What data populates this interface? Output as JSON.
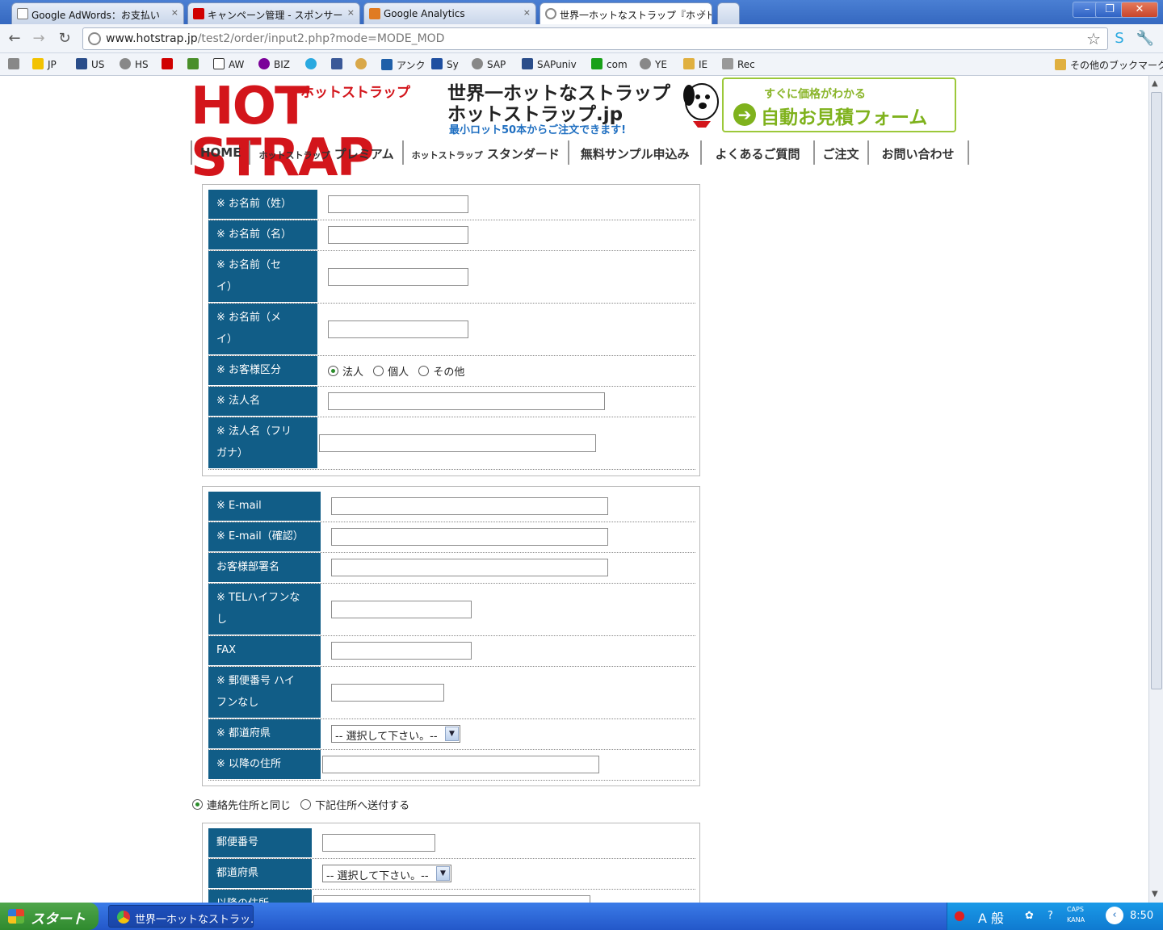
{
  "browser": {
    "tabs": [
      {
        "title": "Google AdWords：お支払い",
        "favicon_color": "#e8e8e8"
      },
      {
        "title": "キャンペーン管理 - スポンサー",
        "favicon_color": "#d00000"
      },
      {
        "title": "Google Analytics",
        "favicon_color": "#e07b22"
      },
      {
        "title": "世界一ホットなストラップ『ホット",
        "favicon_color": "#cfcfcf"
      }
    ],
    "tab_close_glyph": "×",
    "window_buttons": [
      "–",
      "❐",
      "✕"
    ],
    "url_host": "www.hotstrap.jp",
    "url_path": "/test2/order/input2.php?mode=MODE_MOD",
    "bookmarks": [
      {
        "label": "",
        "color": "#888"
      },
      {
        "label": "JP",
        "color": "#f2c200"
      },
      {
        "label": "US",
        "color": "#2a4d8a"
      },
      {
        "label": "HS",
        "color": "#888"
      },
      {
        "label": "",
        "color": "#d00000"
      },
      {
        "label": "",
        "color": "#4a8f2a"
      },
      {
        "label": "AW",
        "color": "#1a1a1a"
      },
      {
        "label": "BIZ",
        "color": "#7b0099"
      },
      {
        "label": "",
        "color": "#2aa9e0"
      },
      {
        "label": "",
        "color": "#3b5998"
      },
      {
        "label": "",
        "color": "#d9a84a"
      },
      {
        "label": "アンク",
        "color": "#1f5fa8"
      },
      {
        "label": "Sy",
        "color": "#1f4fa0"
      },
      {
        "label": "SAP",
        "color": "#888"
      },
      {
        "label": "SAPuniv",
        "color": "#2a4d8a"
      },
      {
        "label": "com",
        "color": "#19a019"
      },
      {
        "label": "YE",
        "color": "#888"
      },
      {
        "label": "IE",
        "color": "#e0b040"
      },
      {
        "label": "Rec",
        "color": "#999"
      }
    ],
    "other_bookmarks": "その他のブックマーク"
  },
  "header": {
    "logo_text": "HOT STRAP",
    "logo_kana": "ホットストラップ",
    "tagline_line1": "世界一ホットなストラップ",
    "tagline_line2": "ホットストラップ.jp",
    "tagline_line3": "最小ロット50本からご注文できます!",
    "estimate_small": "すぐに価格がわかる",
    "estimate_main": "自動お見積フォーム",
    "estimate_arrow": "➔"
  },
  "nav": [
    {
      "label": "HOME"
    },
    {
      "label_small": "ホットストラップ",
      "label": "プレミアム"
    },
    {
      "label_small": "ホットストラップ",
      "label": "スタンダード"
    },
    {
      "label": "無料サンプル申込み"
    },
    {
      "label": "よくあるご質問"
    },
    {
      "label": "ご注文"
    },
    {
      "label": "お問い合わせ"
    }
  ],
  "form1": {
    "last_name": "※ お名前（姓）",
    "first_name": "※ お名前（名）",
    "last_kana": [
      "※ お名前（セ",
      "イ）"
    ],
    "first_kana": [
      "※ お名前（メ",
      "イ）"
    ],
    "customer_type": "※ お客様区分",
    "customer_type_options": [
      "法人",
      "個人",
      "その他"
    ],
    "company": "※ 法人名",
    "company_kana": [
      "※ 法人名（フリ",
      "ガナ）"
    ]
  },
  "form2": {
    "email": "※ E-mail",
    "email_confirm": "※ E-mail（確認）",
    "department": "お客様部署名",
    "tel": [
      "※ TELハイフンな",
      "し"
    ],
    "fax": "FAX",
    "postal": [
      "※ 郵便番号 ハイ",
      "フンなし"
    ],
    "prefecture": "※ 都道府県",
    "prefecture_select": "-- 選択して下さい。--",
    "address": "※ 以降の住所"
  },
  "shipping_choice": [
    "連絡先住所と同じ",
    "下記住所へ送付する"
  ],
  "form3": {
    "postal": "郵便番号",
    "prefecture": "都道府県",
    "prefecture_select": "-- 選択して下さい。--",
    "address": "以降の住所"
  },
  "taskbar": {
    "start": "スタート",
    "window_title": "世界一ホットなストラッ...",
    "ime": "A 般",
    "caps": "CAPS",
    "kana": "KANA",
    "clock": "8:50"
  }
}
